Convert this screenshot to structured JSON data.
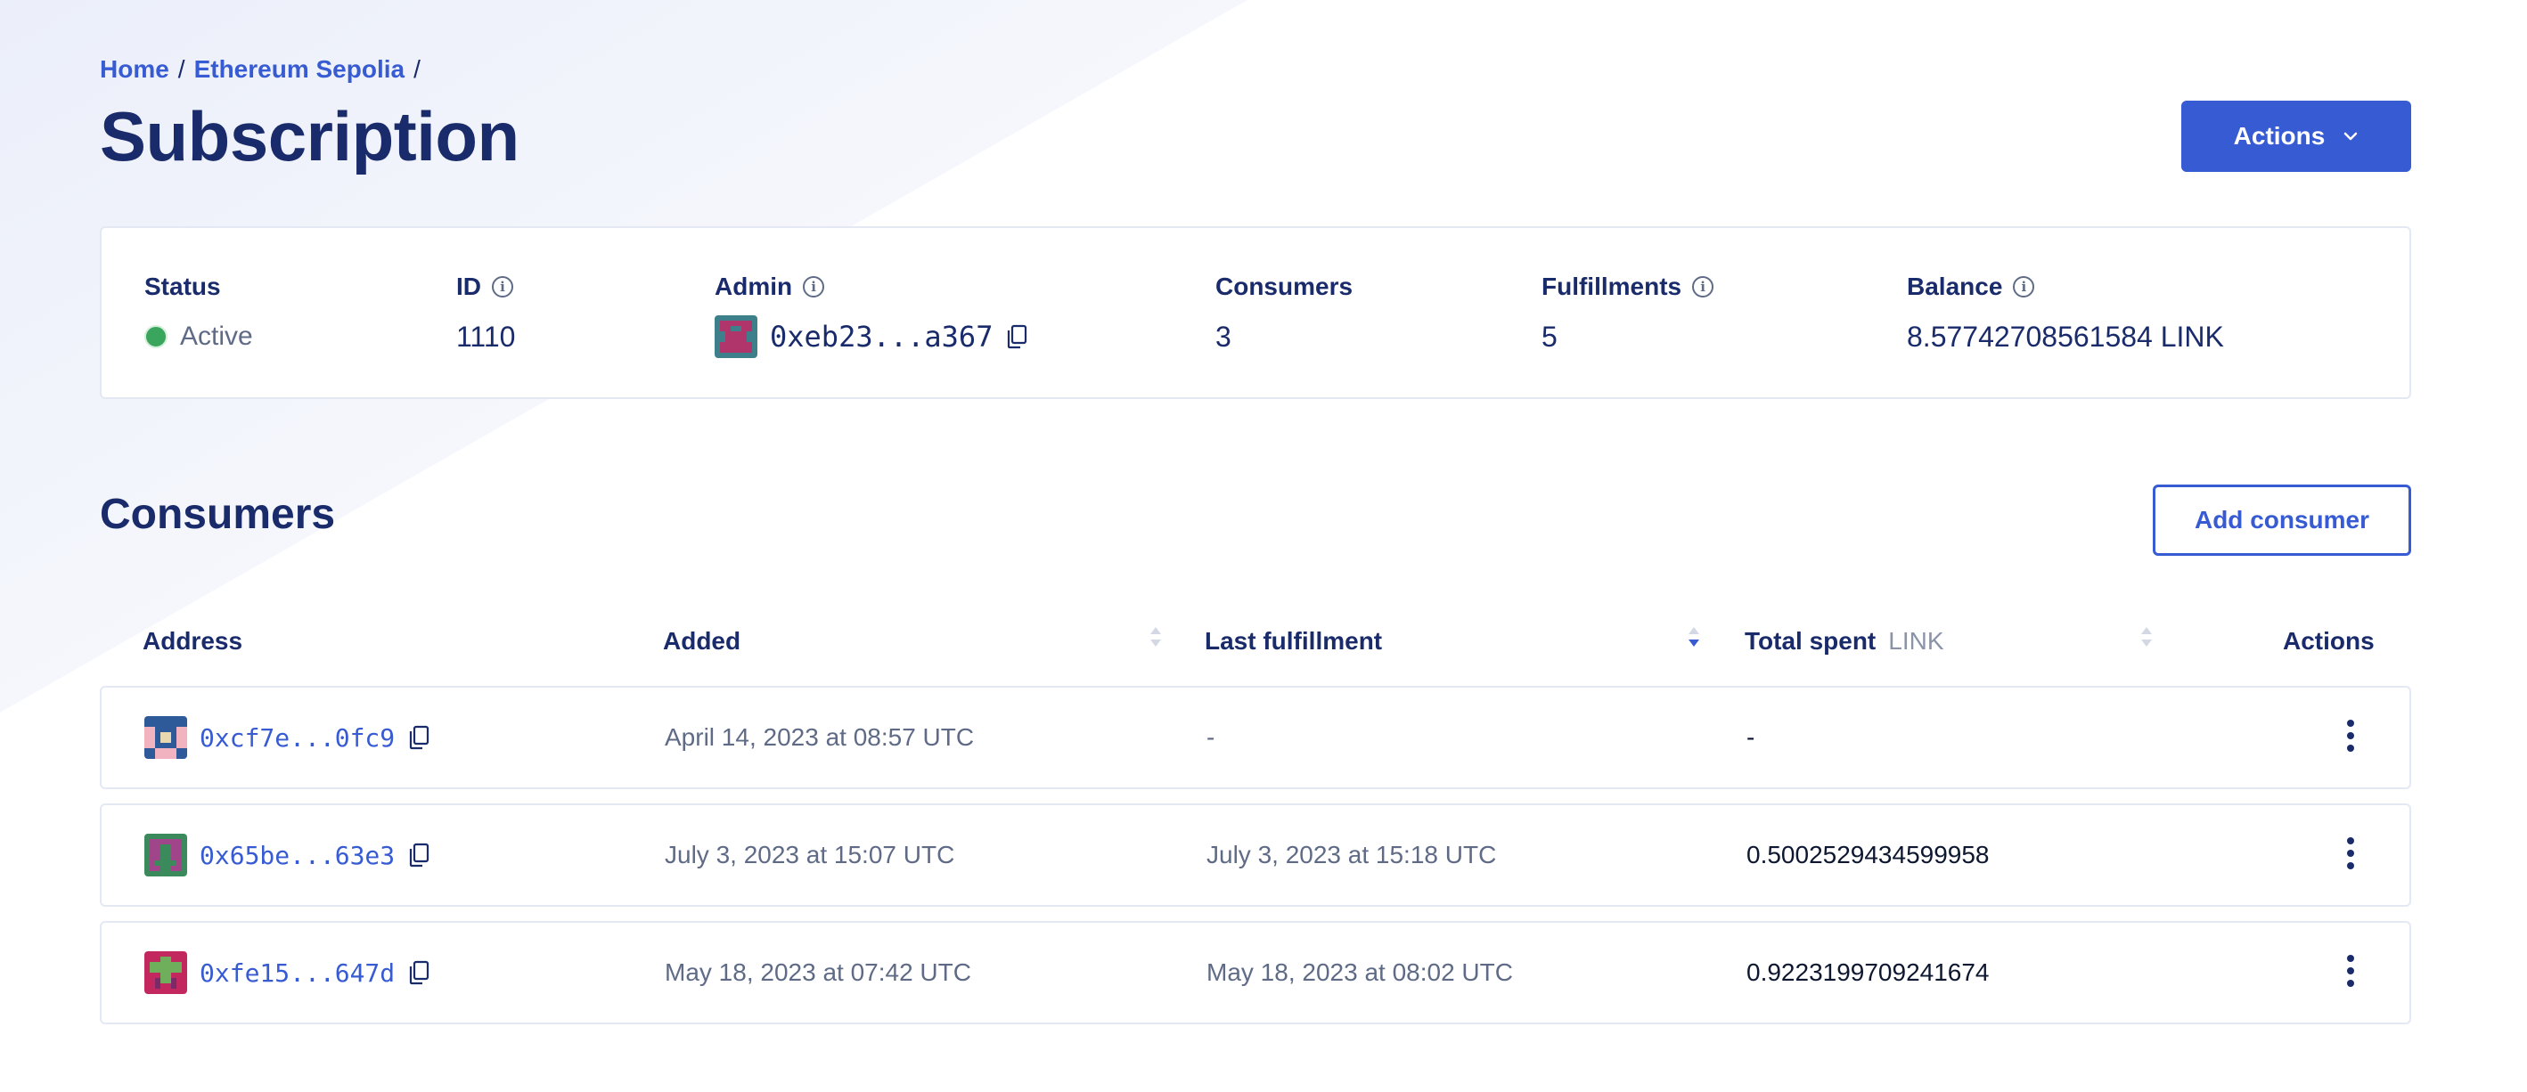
{
  "breadcrumb": {
    "home": "Home",
    "network": "Ethereum Sepolia",
    "separator": "/"
  },
  "page": {
    "title": "Subscription",
    "actions_label": "Actions"
  },
  "summary": {
    "status": {
      "label": "Status",
      "value": "Active",
      "color": "#3aa55d"
    },
    "id": {
      "label": "ID",
      "value": "1110"
    },
    "admin": {
      "label": "Admin",
      "value": "0xeb23...a367"
    },
    "consumers": {
      "label": "Consumers",
      "value": "3"
    },
    "fulfillments": {
      "label": "Fulfillments",
      "value": "5"
    },
    "balance": {
      "label": "Balance",
      "value": "8.57742708561584 LINK"
    }
  },
  "consumers_section": {
    "title": "Consumers",
    "add_button": "Add consumer",
    "columns": {
      "address": "Address",
      "added": "Added",
      "last_fulfillment": "Last fulfillment",
      "total_spent": "Total spent",
      "total_spent_unit": "LINK",
      "actions": "Actions"
    },
    "rows": [
      {
        "address": "0xcf7e...0fc9",
        "added": "April 14, 2023 at 08:57 UTC",
        "last_fulfillment": "-",
        "total_spent": "-"
      },
      {
        "address": "0x65be...63e3",
        "added": "July 3, 2023 at 15:07 UTC",
        "last_fulfillment": "July 3, 2023 at 15:18 UTC",
        "total_spent": "0.5002529434599958"
      },
      {
        "address": "0xfe15...647d",
        "added": "May 18, 2023 at 07:42 UTC",
        "last_fulfillment": "May 18, 2023 at 08:02 UTC",
        "total_spent": "0.9223199709241674"
      }
    ]
  },
  "colors": {
    "accent": "#375bd2",
    "heading": "#1a2b6b",
    "muted": "#5f6b86"
  }
}
